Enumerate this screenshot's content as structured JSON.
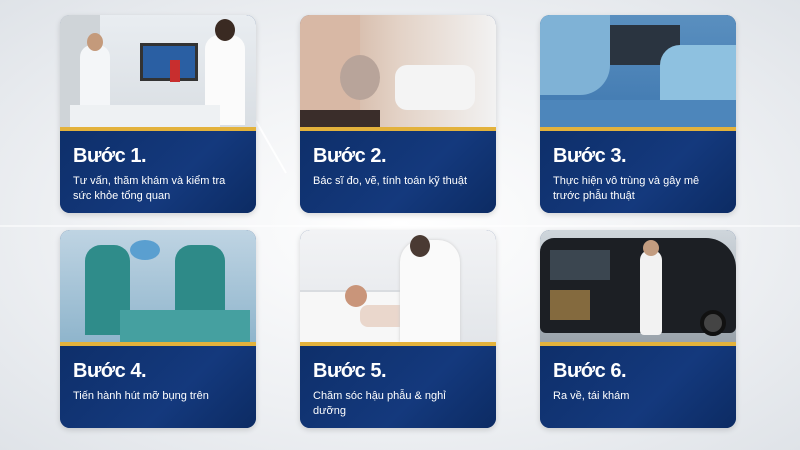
{
  "steps": [
    {
      "title": "Bước 1.",
      "desc": "Tư vấn, thăm khám và kiểm tra sức khỏe tổng quan",
      "photo": "doctor-consultation-photo"
    },
    {
      "title": "Bước 2.",
      "desc": "Bác sĩ đo, vẽ, tính toán kỹ thuật",
      "photo": "doctor-measuring-photo"
    },
    {
      "title": "Bước 3.",
      "desc": "Thực hiện vô trùng và gây mê trước phẫu thuật",
      "photo": "sterile-preparation-photo"
    },
    {
      "title": "Bước 4.",
      "desc": "Tiến hành hút mỡ bụng trên",
      "photo": "surgery-photo"
    },
    {
      "title": "Bước 5.",
      "desc": "Chăm sóc hậu phẫu & nghỉ dưỡng",
      "photo": "post-op-care-photo"
    },
    {
      "title": "Bước 6.",
      "desc": "Ra về, tái khám",
      "photo": "discharge-photo"
    }
  ],
  "colors": {
    "card_blue": "#0f3270",
    "gold": "#e3b23c"
  }
}
